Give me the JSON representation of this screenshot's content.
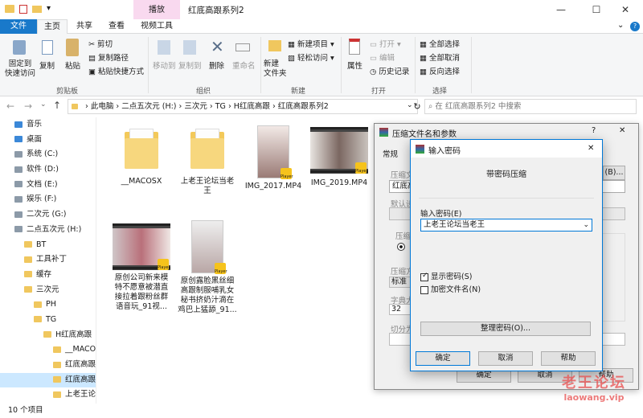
{
  "window": {
    "title": "红底高跟系列2",
    "context_tab": "播放",
    "minimize": "—",
    "maximize": "☐",
    "close": "✕",
    "qat_down": "▾"
  },
  "tabs": [
    {
      "label": "文件"
    },
    {
      "label": "主页"
    },
    {
      "label": "共享"
    },
    {
      "label": "查看"
    },
    {
      "label": "视频工具"
    }
  ],
  "ribbon": {
    "pin_label": "固定到\n快速访问",
    "copy_label": "复制",
    "paste_label": "粘贴",
    "cut_label": "剪切",
    "copy_path_label": "复制路径",
    "paste_shortcut_label": "粘贴快捷方式",
    "clipboard_label": "剪贴板",
    "move_to_label": "移动到",
    "copy_to_label": "复制到",
    "delete_label": "删除",
    "rename_label": "重命名",
    "organize_label": "组织",
    "new_folder_label": "新建\n文件夹",
    "new_item_label": "新建项目 ▾",
    "easy_access_label": "轻松访问 ▾",
    "new_label": "新建",
    "properties_label": "属性",
    "open_label": "打开 ▾",
    "edit_label": "编辑",
    "history_label": "历史记录",
    "open_group_label": "打开",
    "select_all_label": "全部选择",
    "select_none_label": "全部取消",
    "invert_label": "反向选择",
    "select_label": "选择"
  },
  "address": {
    "path": [
      "此电脑",
      "二点五次元 (H:)",
      "三次元",
      "TG",
      "H红底高跟",
      "红底高跟系列2"
    ],
    "search_placeholder": "在 红底高跟系列2 中搜索"
  },
  "nav": [
    {
      "label": "音乐",
      "indent": 1
    },
    {
      "label": "桌面",
      "indent": 1
    },
    {
      "label": "系统 (C:)",
      "indent": 1
    },
    {
      "label": "软件 (D:)",
      "indent": 1
    },
    {
      "label": "文档 (E:)",
      "indent": 1
    },
    {
      "label": "娱乐 (F:)",
      "indent": 1
    },
    {
      "label": "二次元 (G:)",
      "indent": 1
    },
    {
      "label": "二点五次元 (H:)",
      "indent": 1
    },
    {
      "label": "BT",
      "indent": 2
    },
    {
      "label": "工具补丁",
      "indent": 2
    },
    {
      "label": "缓存",
      "indent": 2
    },
    {
      "label": "三次元",
      "indent": 2
    },
    {
      "label": "PH",
      "indent": 3
    },
    {
      "label": "TG",
      "indent": 3
    },
    {
      "label": "H红底高跟",
      "indent": 4
    },
    {
      "label": "__MACOS",
      "indent": 5
    },
    {
      "label": "红底高跟系",
      "indent": 5
    },
    {
      "label": "红底高跟系",
      "indent": 5,
      "selected": true
    },
    {
      "label": "上老王论坛",
      "indent": 5
    }
  ],
  "files": [
    {
      "name": "__MACOSX",
      "kind": "folder"
    },
    {
      "name": "上老王论坛当老\n王",
      "kind": "folder"
    },
    {
      "name": "IMG_2017.MP4",
      "kind": "video-portrait"
    },
    {
      "name": "IMG_2019.MP4",
      "kind": "video-landscape"
    },
    {
      "name": "原创公司新来模\n特不愿意被潜直\n接拉着跟粉丝群\n语音玩_91视...",
      "kind": "video-landscape"
    },
    {
      "name": "原创露脸黑丝细\n高跟制服哺乳女\n秘书挤奶汁滴在\n鸡巴上猛舔_91...",
      "kind": "video-portrait"
    }
  ],
  "badge": "Player",
  "status": {
    "count": "10 个项目"
  },
  "compress_dialog": {
    "title": "压缩文件名和参数",
    "help": "?",
    "close": "✕",
    "tab_general": "常规",
    "archive_name_label": "压缩文",
    "browse_button": "(B)...",
    "archive_name_value": "红底高",
    "default_label": "默认设",
    "format_label": "压缩",
    "method_label": "压缩方",
    "method_value": "标准",
    "dict_label": "字典大",
    "dict_value": "32",
    "split_label": "切分为",
    "ok": "确定",
    "cancel": "取消",
    "help_btn": "帮助"
  },
  "password_dialog": {
    "title": "输入密码",
    "close": "✕",
    "subtitle": "带密码压缩",
    "field_label": "输入密码(E)",
    "field_value": "上老王论坛当老王",
    "show_password": "显示密码(S)",
    "encrypt_names": "加密文件名(N)",
    "organize": "整理密码(O)...",
    "ok": "确定",
    "cancel": "取消",
    "help": "帮助"
  },
  "watermark": {
    "line1": "老王论坛",
    "line2": "laowang.vip"
  }
}
